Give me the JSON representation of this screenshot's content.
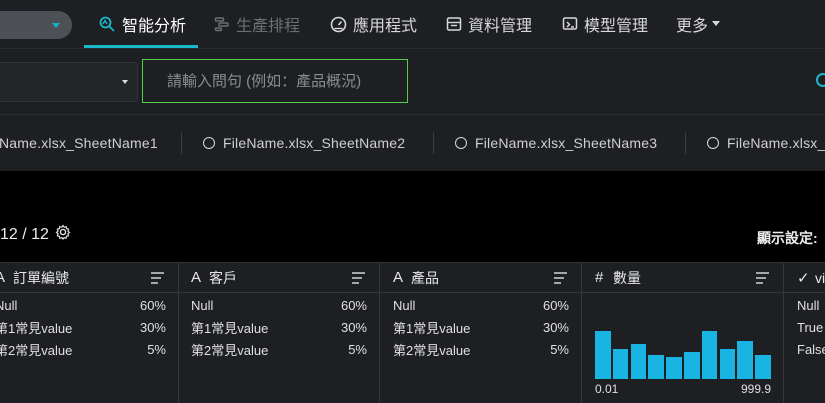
{
  "nav": {
    "items": [
      {
        "label": "智能分析",
        "icon": "ai-analysis-icon",
        "state": "active"
      },
      {
        "label": "生產排程",
        "icon": "schedule-icon",
        "state": "disabled"
      },
      {
        "label": "應用程式",
        "icon": "dashboard-gauge-icon",
        "state": "normal"
      },
      {
        "label": "資料管理",
        "icon": "data-table-icon",
        "state": "normal"
      },
      {
        "label": "模型管理",
        "icon": "model-icon",
        "state": "normal"
      },
      {
        "label": "更多",
        "icon": "caret-down-icon",
        "state": "normal"
      }
    ]
  },
  "query": {
    "placeholder": "請輸入問句 (例如：產品概況)"
  },
  "sheets": [
    {
      "label": "Name.xlsx_SheetName1",
      "radio": false
    },
    {
      "label": "FileName.xlsx_SheetName2",
      "radio": true
    },
    {
      "label": "FileName.xlsx_SheetName3",
      "radio": true
    },
    {
      "label": "FileName.xlsx_",
      "radio": true
    }
  ],
  "summary": {
    "count": "12 / 12",
    "display_settings": "顯示設定:"
  },
  "columns": [
    {
      "type_glyph": "A",
      "title": "訂單編號",
      "rows": [
        [
          "Null",
          "60%"
        ],
        [
          "第1常見value",
          "30%"
        ],
        [
          "第2常見value",
          "5%"
        ]
      ]
    },
    {
      "type_glyph": "A",
      "title": "客戶",
      "rows": [
        [
          "Null",
          "60%"
        ],
        [
          "第1常見value",
          "30%"
        ],
        [
          "第2常見value",
          "5%"
        ]
      ]
    },
    {
      "type_glyph": "A",
      "title": "產品",
      "rows": [
        [
          "Null",
          "60%"
        ],
        [
          "第1常見value",
          "30%"
        ],
        [
          "第2常見value",
          "5%"
        ]
      ]
    },
    {
      "type_glyph": "#",
      "title": "數量",
      "histogram": {
        "min": "0.01",
        "max": "999.9",
        "values": [
          48,
          30,
          35,
          24,
          22,
          27,
          48,
          30,
          38,
          24
        ]
      }
    },
    {
      "type_glyph": "✓",
      "title": "vi",
      "rows": [
        [
          "Null",
          ""
        ],
        [
          "True",
          ""
        ],
        [
          "False",
          ""
        ]
      ]
    }
  ],
  "colors": {
    "accent": "#1ab8c8",
    "focus_border": "#4fd14b",
    "histogram_bar": "#19b4e2",
    "panel": "#1d1f22"
  }
}
